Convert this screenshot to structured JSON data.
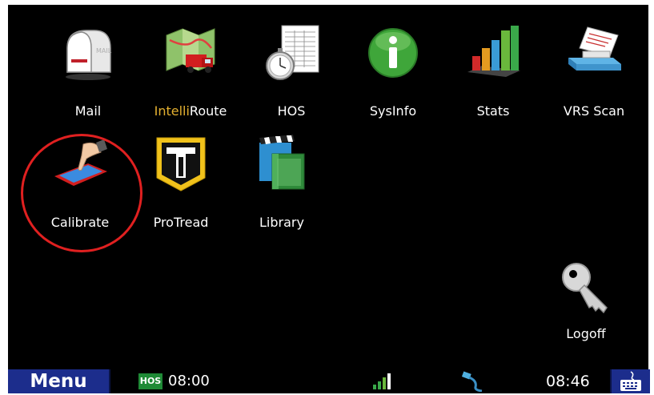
{
  "apps": {
    "mail": {
      "label": "Mail",
      "icon": "mailbox-icon"
    },
    "intelliroute": {
      "label_accent": "Intelli",
      "label_rest": "Route",
      "icon": "route-map-truck-icon"
    },
    "hos": {
      "label": "HOS",
      "icon": "logbook-stopwatch-icon"
    },
    "sysinfo": {
      "label": "SysInfo",
      "icon": "info-icon"
    },
    "stats": {
      "label": "Stats",
      "icon": "bar-chart-icon"
    },
    "vrs_scan": {
      "label": "VRS Scan",
      "icon": "scanner-icon"
    },
    "calibrate": {
      "label": "Calibrate",
      "icon": "touch-screen-icon"
    },
    "protread": {
      "label": "ProTread",
      "icon": "protread-logo-icon"
    },
    "library": {
      "label": "Library",
      "icon": "clapperboard-book-icon"
    },
    "logoff": {
      "label": "Logoff",
      "icon": "key-icon"
    }
  },
  "taskbar": {
    "menu_label": "Menu",
    "hos_badge": "HOS",
    "hos_time": "08:00",
    "clock": "08:46",
    "signal_icon": "signal-strength-icon",
    "network_icon": "network-cable-icon",
    "keyboard_icon": "keyboard-icon"
  },
  "colors": {
    "background": "#000000",
    "taskbar_button": "#1c2d8c",
    "hos_badge": "#1f8a36",
    "highlight_ring": "#e02020",
    "intelli_accent": "#e3b030"
  },
  "highlight": {
    "target": "calibrate"
  }
}
